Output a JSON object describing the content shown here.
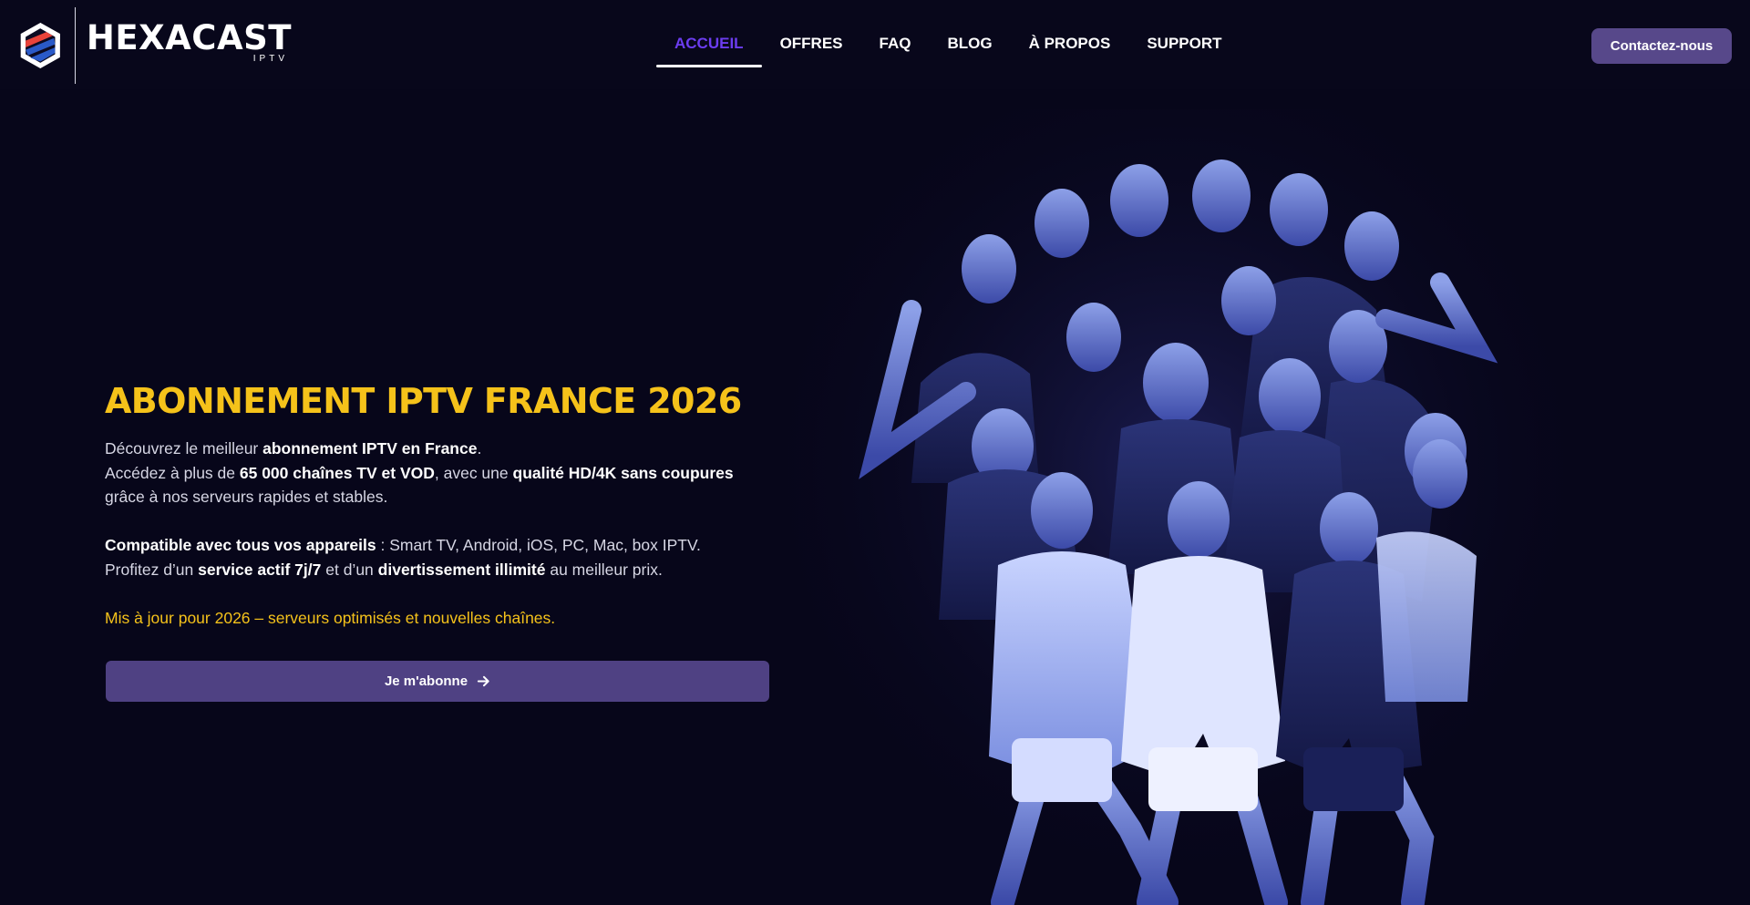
{
  "brand": {
    "name": "HEXACAST",
    "sub": "IPTV",
    "colors": {
      "red": "#e8433a",
      "blue": "#2a5ac8",
      "white": "#ffffff"
    }
  },
  "nav": {
    "items": [
      {
        "label": "ACCUEIL",
        "active": true
      },
      {
        "label": "OFFRES",
        "active": false
      },
      {
        "label": "FAQ",
        "active": false
      },
      {
        "label": "BLOG",
        "active": false
      },
      {
        "label": "À PROPOS",
        "active": false
      },
      {
        "label": "SUPPORT",
        "active": false
      }
    ],
    "active_color": "#6c3df0"
  },
  "header": {
    "contact_label": "Contactez-nous"
  },
  "hero": {
    "title": "ABONNEMENT IPTV FRANCE 2026",
    "line1": {
      "pre": "Découvrez le meilleur ",
      "bold": "abonnement IPTV en France",
      "post": "."
    },
    "line2": {
      "pre": "Accédez à plus de ",
      "bold1": "65 000 chaînes TV et VOD",
      "mid": ", avec une ",
      "bold2": "qualité HD/4K sans coupures"
    },
    "line3": "grâce à nos serveurs rapides et stables.",
    "line4": {
      "bold": "Compatible avec tous vos appareils",
      "post": " : Smart TV, Android, iOS, PC, Mac, box IPTV."
    },
    "line5": {
      "pre": "Profitez d’un ",
      "bold1": "service actif 7j/7",
      "mid": " et d’un ",
      "bold2": "divertissement illimité",
      "post": " au meilleur prix."
    },
    "update": "Mis à jour pour 2026 – serveurs optimisés et nouvelles chaînes.",
    "cta_label": "Je m'abonne",
    "accent_color": "#f5c21a"
  },
  "icons": {
    "logo": "hexagon-logo-icon",
    "cta_arrow": "arrow-right-icon"
  }
}
